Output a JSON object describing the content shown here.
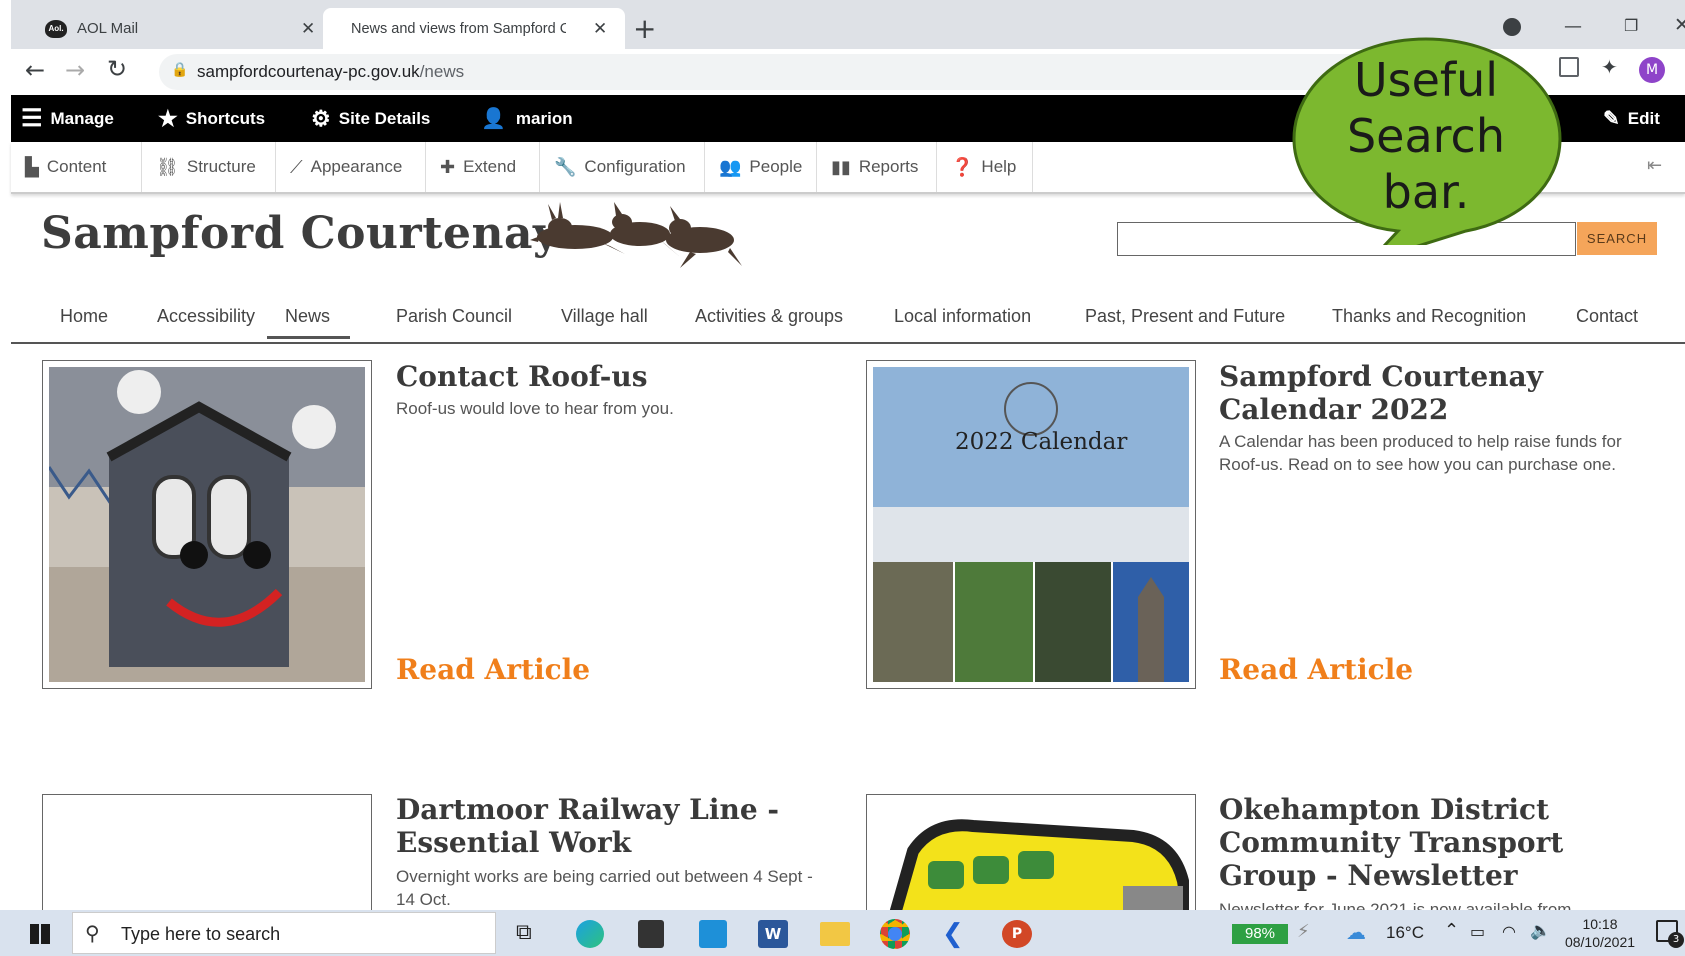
{
  "browser": {
    "tabs": [
      {
        "title": "AOL Mail",
        "icon": "aol-icon"
      },
      {
        "title": "News and views from Sampford C",
        "icon": "site-icon"
      }
    ],
    "new_tab": "+",
    "url_domain": "sampfordcourtenay-pc.gov.uk",
    "url_path": "/news",
    "profile_initial": "M"
  },
  "admin_toolbar": {
    "manage": "Manage",
    "shortcuts": "Shortcuts",
    "site_details": "Site Details",
    "user": "marion",
    "edit": "Edit"
  },
  "admin_menu": [
    "Content",
    "Structure",
    "Appearance",
    "Extend",
    "Configuration",
    "People",
    "Reports",
    "Help"
  ],
  "site": {
    "name": "Sampford Courtenay",
    "search_button": "SEARCH",
    "search_value": ""
  },
  "nav": [
    "Home",
    "Accessibility",
    "News",
    "Parish Council",
    "Village hall",
    "Activities & groups",
    "Local information",
    "Past, Present and Future",
    "Thanks and Recognition",
    "Contact"
  ],
  "articles": [
    {
      "title": "Contact Roof-us",
      "summary": "Roof-us would love to hear from you.",
      "link": "Read Article"
    },
    {
      "title": "Sampford Courtenay Calendar 2022",
      "summary": "A Calendar has been produced to help raise funds for Roof-us. Read on to see how you can purchase one.",
      "link": "Read Article",
      "image_text": "2022 Calendar"
    },
    {
      "title": "Dartmoor Railway Line - Essential Work",
      "summary": "Overnight works are being carried out between 4 Sept - 14 Oct."
    },
    {
      "title": "Okehampton District Community Transport Group - Newsletter",
      "summary": "Newsletter for June 2021 is now available from"
    }
  ],
  "callout": {
    "text_lines": [
      "Useful",
      "Search",
      "bar."
    ],
    "color": "#7cb82f"
  },
  "taskbar": {
    "search_placeholder": "Type here to search",
    "battery": "98%",
    "temperature": "16°C",
    "time": "10:18",
    "date": "08/10/2021",
    "notifications": "3"
  },
  "colors": {
    "accent": "#f07f1b",
    "admin_bar": "#000000"
  }
}
